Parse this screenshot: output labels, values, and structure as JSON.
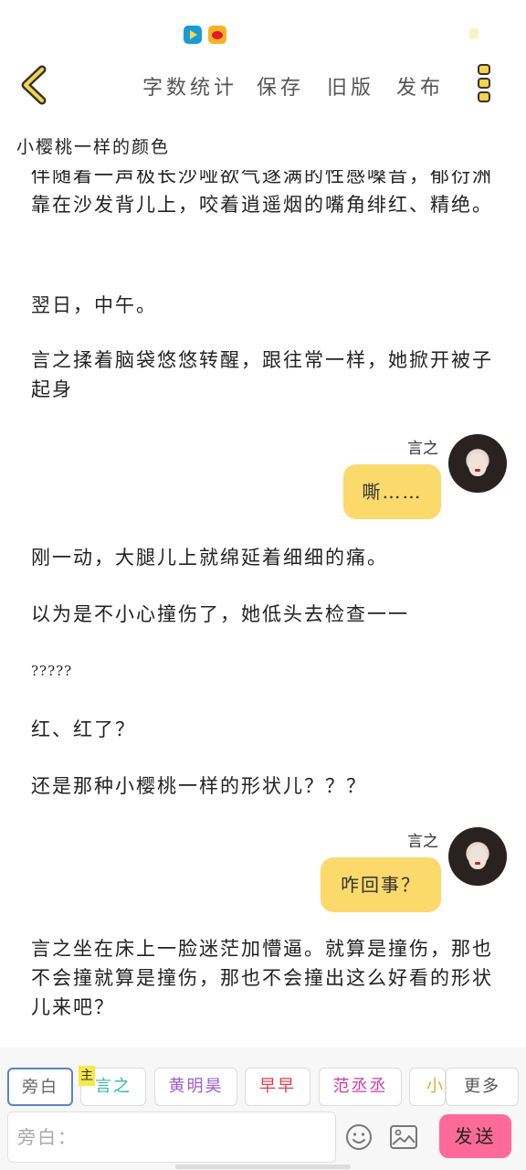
{
  "status_bar": {
    "icons": [
      "tencent-video-icon",
      "weibo-icon",
      "battery-dot-icon"
    ]
  },
  "toolbar": {
    "back_icon": "chevron-left-icon",
    "word_count": "字数统计",
    "save": "保存",
    "old_version": "旧版",
    "publish": "发布",
    "more_icon": "vertical-dots-icon"
  },
  "chapter": {
    "title": "小樱桃一样的颜色"
  },
  "story": {
    "p1": "伴随着一声极长沙哑欲气逐满的性感嗓音，郁衍洲靠在沙发背儿上，咬着逍遥烟的嘴角绯红、精绝。",
    "p2": "翌日，中午。",
    "p3": "言之揉着脑袋悠悠转醒，跟往常一样，她掀开被子起身",
    "dialog1": {
      "speaker": "言之",
      "text": "嘶……"
    },
    "p4": "刚一动，大腿儿上就绵延着细细的痛。",
    "p5": "以为是不小心撞伤了，她低头去检查一一",
    "p6": "?????",
    "p7": "红、红了？",
    "p8": "还是那种小樱桃一样的形状儿？？？",
    "dialog2": {
      "speaker": "言之",
      "text": "咋回事？"
    },
    "p9": "言之坐在床上一脸迷茫加懵逼。就算是撞伤，那也不会撞就算是撞伤，那也不会撞出这么好看的形状儿来吧？"
  },
  "roles": {
    "narration": "旁白",
    "main_tag": "主",
    "yanzhi": "言之",
    "huangmingyu": "黄明昊",
    "zaozao": "早早",
    "fanchengcheng": "范丞丞",
    "partial": "小",
    "more": "更多"
  },
  "role_colors": {
    "narration": "#666666",
    "yanzhi": "#36b5a8",
    "huangmingyu": "#9a5bd0",
    "zaozao": "#e0404a",
    "fanchengcheng": "#d23aa0",
    "partial": "#e7a63a",
    "more": "#555555"
  },
  "input": {
    "placeholder": "旁白："
  },
  "actions": {
    "emoji_icon": "smiley-icon",
    "image_icon": "image-icon",
    "send": "发送"
  },
  "colors": {
    "accent_yellow": "#fbd96b",
    "send_pink": "#ff6a9a",
    "active_border": "#5b84c4"
  }
}
